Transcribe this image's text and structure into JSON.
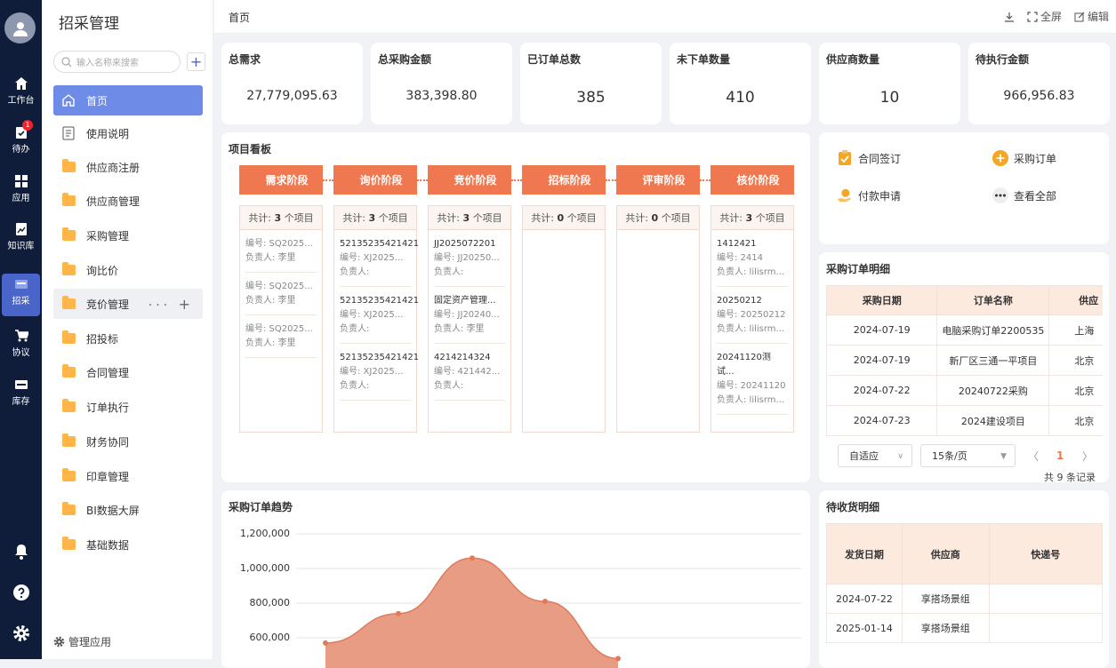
{
  "rail": {
    "items": [
      {
        "label": "工作台",
        "icon": "home-icon"
      },
      {
        "label": "待办",
        "icon": "todo-icon",
        "badge": "1"
      },
      {
        "label": "应用",
        "icon": "apps-icon"
      },
      {
        "label": "知识库",
        "icon": "knowledge-icon"
      },
      {
        "label": "招采",
        "icon": "procurement-icon"
      },
      {
        "label": "协议",
        "icon": "cart-icon"
      },
      {
        "label": "库存",
        "icon": "wms-icon"
      }
    ],
    "active": "招采"
  },
  "nav": {
    "title": "招采管理",
    "search_placeholder": "输入名称来搜索",
    "items": [
      {
        "label": "首页",
        "icon": "home-icon"
      },
      {
        "label": "使用说明",
        "icon": "document-icon"
      },
      {
        "label": "供应商注册",
        "icon": "folder-icon"
      },
      {
        "label": "供应商管理",
        "icon": "folder-icon"
      },
      {
        "label": "采购管理",
        "icon": "folder-icon"
      },
      {
        "label": "询比价",
        "icon": "folder-icon"
      },
      {
        "label": "竞价管理",
        "icon": "folder-icon"
      },
      {
        "label": "招投标",
        "icon": "folder-icon"
      },
      {
        "label": "合同管理",
        "icon": "folder-icon"
      },
      {
        "label": "订单执行",
        "icon": "folder-icon"
      },
      {
        "label": "财务协同",
        "icon": "folder-icon"
      },
      {
        "label": "印章管理",
        "icon": "folder-icon"
      },
      {
        "label": "BI数据大屏",
        "icon": "folder-icon"
      },
      {
        "label": "基础数据",
        "icon": "folder-icon"
      }
    ],
    "footer": "管理应用"
  },
  "topbar": {
    "breadcrumb": "首页",
    "fullscreen": "全屏",
    "edit": "编辑"
  },
  "stats": [
    {
      "title": "总需求",
      "value": "27,779,095.63"
    },
    {
      "title": "总采购金额",
      "value": "383,398.80"
    },
    {
      "title": "已订单总数",
      "value": "385"
    },
    {
      "title": "未下单数量",
      "value": "410"
    },
    {
      "title": "供应商数量",
      "value": "10"
    },
    {
      "title": "待执行金额",
      "value": "966,956.83"
    }
  ],
  "board": {
    "title": "项目看板",
    "count_prefix": "共计:",
    "count_suffix": "个项目",
    "columns": [
      {
        "stage": "需求阶段",
        "icon": "send-icon",
        "count": "3",
        "items": [
          {
            "title": "",
            "code": "编号: SQ2025...",
            "owner": "负责人: 李里"
          },
          {
            "title": "",
            "code": "编号: SQ2025...",
            "owner": "负责人: 李里"
          },
          {
            "title": "",
            "code": "编号: SQ2025...",
            "owner": "负责人: 李里"
          }
        ]
      },
      {
        "stage": "询价阶段",
        "icon": "bar-chart-icon",
        "count": "3",
        "items": [
          {
            "title": "52135235421421",
            "code": "编号: XJ2025...",
            "owner": "负责人:"
          },
          {
            "title": "52135235421421",
            "code": "编号: XJ2025...",
            "owner": "负责人:"
          },
          {
            "title": "52135235421421",
            "code": "编号: XJ2025...",
            "owner": "负责人:"
          }
        ]
      },
      {
        "stage": "竞价阶段",
        "icon": "bulb-icon",
        "count": "3",
        "items": [
          {
            "title": "JJ2025072201",
            "code": "编号: JJ20250...",
            "owner": "负责人:"
          },
          {
            "title": "固定资产管理...",
            "code": "编号: JJ20240...",
            "owner": "负责人: 李里"
          },
          {
            "title": "4214214324",
            "code": "编号: 421442...",
            "owner": "负责人:"
          }
        ]
      },
      {
        "stage": "招标阶段",
        "icon": "user-icon",
        "count": "0",
        "items": []
      },
      {
        "stage": "评审阶段",
        "icon": "reviewer-icon",
        "count": "0",
        "items": []
      },
      {
        "stage": "核价阶段",
        "icon": "monitor-icon",
        "count": "3",
        "items": [
          {
            "title": "1412421",
            "code": "编号: 2414",
            "owner": "负责人: lilisrm..."
          },
          {
            "title": "20250212",
            "code": "编号: 20250212",
            "owner": "负责人: lilisrm..."
          },
          {
            "title": "20241120测试...",
            "code": "编号: 20241120",
            "owner": "负责人: lilisrm..."
          }
        ]
      }
    ]
  },
  "quick": [
    {
      "label": "合同签订",
      "icon": "contract-icon"
    },
    {
      "label": "采购订单",
      "icon": "plus-circle-icon"
    },
    {
      "label": "付款申请",
      "icon": "payment-icon"
    },
    {
      "label": "查看全部",
      "icon": "more-icon"
    }
  ],
  "orders": {
    "title": "采购订单明细",
    "headers": [
      "采购日期",
      "订单名称",
      "供应"
    ],
    "rows": [
      [
        "2024-07-19",
        "电脑采购订单2200535",
        "上海"
      ],
      [
        "2024-07-19",
        "新厂区三通一平项目",
        "北京"
      ],
      [
        "2024-07-22",
        "20240722采购",
        "北京"
      ],
      [
        "2024-07-23",
        "2024建设项目",
        "北京"
      ]
    ],
    "fit_select": "自适应",
    "page_size": "15条/页",
    "page": "1",
    "total": "共 9 条记录"
  },
  "trend": {
    "title": "采购订单趋势",
    "chart_data": {
      "type": "area",
      "y_ticks": [
        "1,200,000",
        "1,000,000",
        "800,000",
        "600,000"
      ],
      "ylim": [
        500000,
        1200000
      ],
      "values": [
        570000,
        740000,
        1060000,
        810000,
        480000
      ]
    }
  },
  "receipts": {
    "title": "待收货明细",
    "headers": [
      "发货日期",
      "供应商",
      "快递号"
    ],
    "rows": [
      [
        "2024-07-22",
        "享搭场景组",
        ""
      ],
      [
        "2025-01-14",
        "享搭场景组",
        ""
      ]
    ]
  },
  "colors": {
    "accent": "#f07850",
    "nav_active": "#6f8be8",
    "rail_bg": "#0f1d3a"
  }
}
